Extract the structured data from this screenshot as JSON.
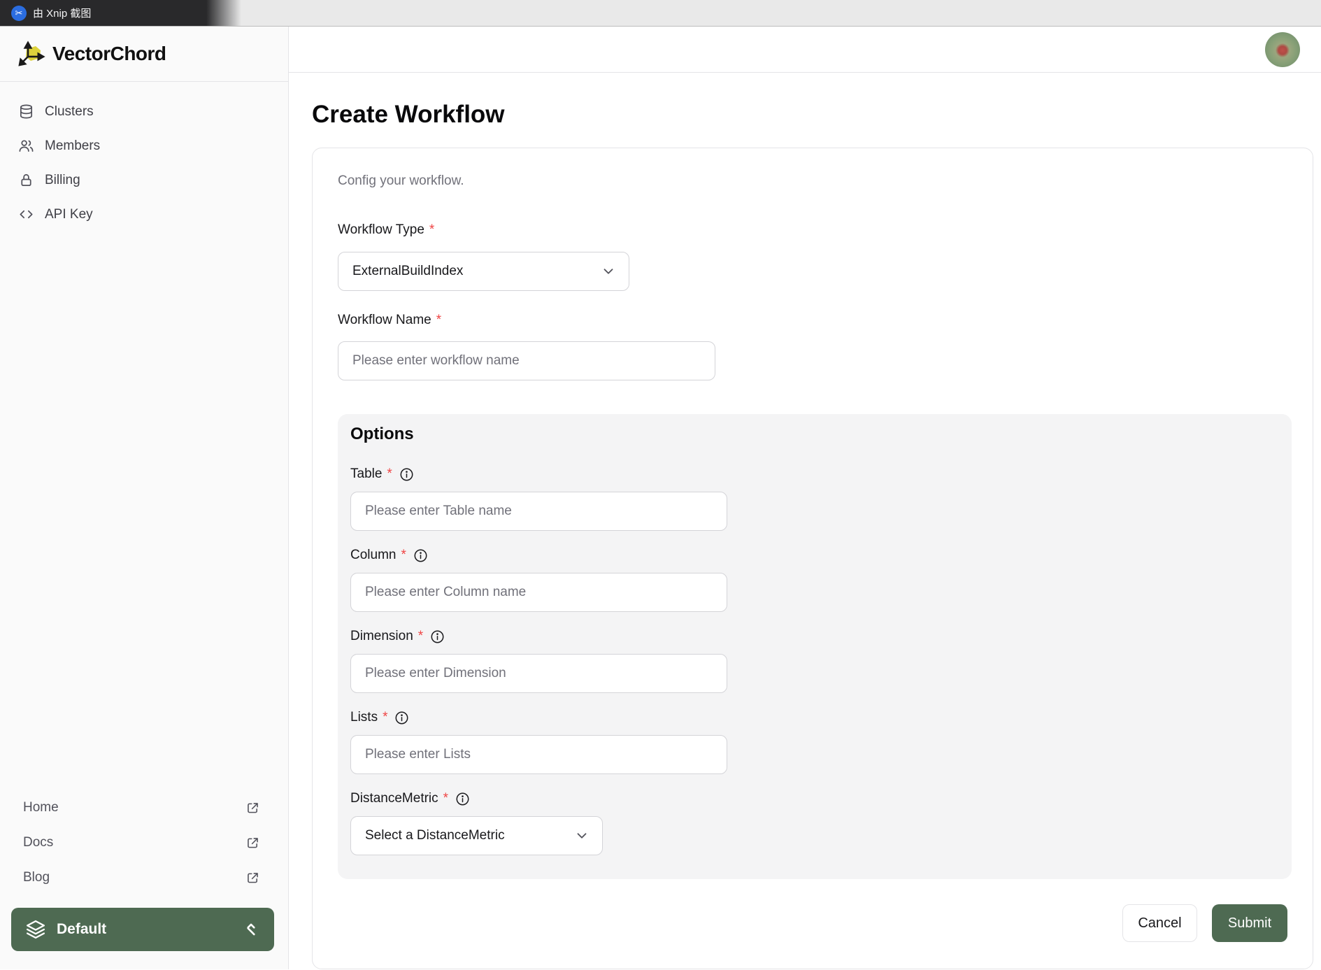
{
  "menubar": {
    "app_label": "由 Xnip 截图"
  },
  "brand": {
    "name": "VectorChord"
  },
  "sidebar": {
    "items": [
      {
        "label": "Clusters",
        "icon": "database-icon"
      },
      {
        "label": "Members",
        "icon": "users-icon"
      },
      {
        "label": "Billing",
        "icon": "lock-icon"
      },
      {
        "label": "API Key",
        "icon": "code-icon"
      }
    ],
    "links": [
      {
        "label": "Home",
        "icon": "external-link-icon"
      },
      {
        "label": "Docs",
        "icon": "external-link-icon"
      },
      {
        "label": "Blog",
        "icon": "external-link-icon"
      }
    ],
    "project_switcher": {
      "label": "Default",
      "icon": "layers-icon"
    }
  },
  "page": {
    "title": "Create Workflow",
    "card": {
      "description": "Config your workflow.",
      "workflow_type": {
        "label": "Workflow Type",
        "value": "ExternalBuildIndex"
      },
      "workflow_name": {
        "label": "Workflow Name",
        "placeholder": "Please enter workflow name"
      },
      "options": {
        "heading": "Options",
        "fields": [
          {
            "label": "Table",
            "placeholder": "Please enter Table name",
            "type": "input"
          },
          {
            "label": "Column",
            "placeholder": "Please enter Column name",
            "type": "input"
          },
          {
            "label": "Dimension",
            "placeholder": "Please enter Dimension",
            "type": "input"
          },
          {
            "label": "Lists",
            "placeholder": "Please enter Lists",
            "type": "input"
          },
          {
            "label": "DistanceMetric",
            "placeholder": "Select a DistanceMetric",
            "type": "select"
          }
        ]
      },
      "actions": {
        "cancel": "Cancel",
        "submit": "Submit"
      }
    }
  },
  "ui": {
    "required_mark": "*"
  },
  "colors": {
    "accent_green": "#4e6a52",
    "required_red": "#ef4444",
    "menubar_dark": "#29292b",
    "options_panel_bg": "#f4f4f5"
  }
}
